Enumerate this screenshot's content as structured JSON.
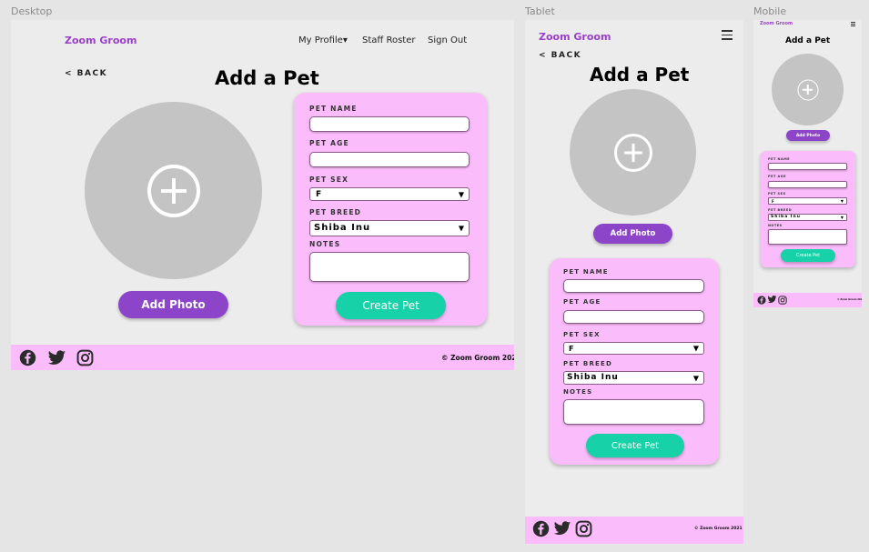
{
  "frames": {
    "desktop": "Desktop",
    "tablet": "Tablet",
    "mobile": "Mobile"
  },
  "brand": "Zoom Groom",
  "nav": {
    "profile": "My Profile▾",
    "roster": "Staff Roster",
    "signout": "Sign Out"
  },
  "back": "< BACK",
  "title": "Add a Pet",
  "add_photo": "Add Photo",
  "form": {
    "name_label": "PET NAME",
    "age_label": "PET AGE",
    "sex_label": "PET SEX",
    "sex_value": "F",
    "breed_label": "PET BREED",
    "breed_value": "Shiba Inu",
    "notes_label": "NOTES",
    "submit": "Create Pet"
  },
  "footer": {
    "copyright": "© Zoom Groom 2021",
    "icons": [
      "facebook-icon",
      "twitter-icon",
      "instagram-icon"
    ]
  },
  "colors": {
    "brand": "#9a3fc9",
    "card": "#fbbcfb",
    "add_photo_btn": "#8c45c8",
    "create_btn": "#17d1a8",
    "photo_placeholder": "#c4c4c4"
  }
}
